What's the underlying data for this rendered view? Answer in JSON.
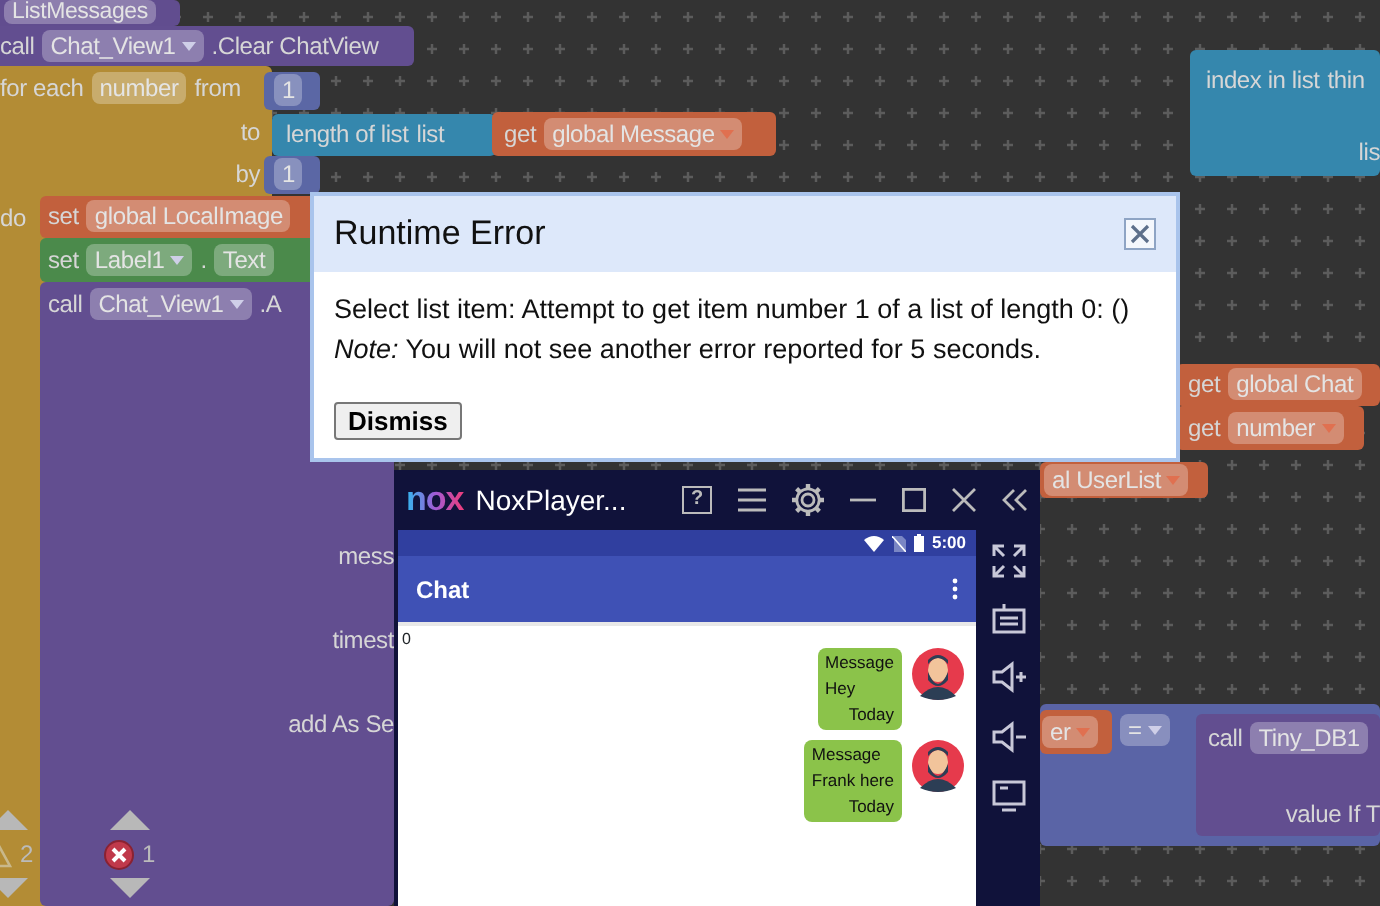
{
  "workspace": {
    "blocks": [
      {
        "kind": "procedure",
        "rows": [
          {
            "parts": [
              {
                "kind": "chip",
                "text": "ListMessages"
              }
            ]
          }
        ]
      },
      {
        "kind": "component",
        "rows": [
          {
            "parts": [
              {
                "kind": "word",
                "text": "call"
              },
              {
                "kind": "chip",
                "text": "Chat_View1",
                "dropdown": true
              },
              {
                "kind": "word",
                "text": ".Clear ChatView"
              }
            ]
          }
        ]
      },
      {
        "kind": "control",
        "rows": [
          {
            "parts": [
              {
                "kind": "word",
                "text": "for each"
              },
              {
                "kind": "chip",
                "text": "number"
              },
              {
                "kind": "word",
                "text": "from"
              }
            ]
          },
          {
            "parts": [
              {
                "kind": "word",
                "text": "to"
              }
            ]
          },
          {
            "parts": [
              {
                "kind": "word",
                "text": "by"
              }
            ]
          },
          {
            "parts": [
              {
                "kind": "word",
                "text": "do"
              }
            ]
          }
        ]
      },
      {
        "kind": "math",
        "rows": [
          {
            "parts": [
              {
                "kind": "chip",
                "text": "1"
              }
            ]
          }
        ]
      },
      {
        "kind": "list",
        "rows": [
          {
            "parts": [
              {
                "kind": "word",
                "text": "length of list"
              },
              {
                "kind": "word",
                "text": "list"
              }
            ]
          }
        ]
      },
      {
        "kind": "variable",
        "rows": [
          {
            "parts": [
              {
                "kind": "word",
                "text": "get"
              },
              {
                "kind": "chip",
                "text": "global Message",
                "dropdown": true
              }
            ]
          }
        ]
      },
      {
        "kind": "math",
        "rows": [
          {
            "parts": [
              {
                "kind": "chip",
                "text": "1"
              }
            ]
          }
        ]
      },
      {
        "kind": "variable",
        "rows": [
          {
            "parts": [
              {
                "kind": "word",
                "text": "set"
              },
              {
                "kind": "chip",
                "text": "global LocalImage"
              }
            ]
          }
        ]
      },
      {
        "kind": "text",
        "rows": [
          {
            "parts": [
              {
                "kind": "word",
                "text": "set"
              },
              {
                "kind": "chip",
                "text": "Label1",
                "dropdown": true
              },
              {
                "kind": "word",
                "text": "."
              },
              {
                "kind": "chip",
                "text": "Text"
              }
            ]
          }
        ]
      },
      {
        "kind": "component",
        "rows": [
          {
            "parts": [
              {
                "kind": "word",
                "text": "call"
              },
              {
                "kind": "chip",
                "text": "Chat_View1",
                "dropdown": true
              },
              {
                "kind": "word",
                "text": ".A"
              }
            ]
          },
          {
            "parts": [
              {
                "kind": "word",
                "text": "mess"
              }
            ]
          },
          {
            "parts": [
              {
                "kind": "word",
                "text": "timest"
              }
            ]
          },
          {
            "parts": [
              {
                "kind": "word",
                "text": "add As Se"
              }
            ]
          }
        ]
      },
      {
        "kind": "list",
        "rows": [
          {
            "parts": [
              {
                "kind": "word",
                "text": "index in list"
              },
              {
                "kind": "word",
                "text": "thin"
              }
            ]
          },
          {
            "parts": [
              {
                "kind": "word",
                "text": "lis"
              }
            ]
          }
        ]
      },
      {
        "kind": "variable",
        "rows": [
          {
            "parts": [
              {
                "kind": "word",
                "text": "get"
              },
              {
                "kind": "chip",
                "text": "global Chat"
              }
            ]
          }
        ]
      },
      {
        "kind": "variable",
        "rows": [
          {
            "parts": [
              {
                "kind": "word",
                "text": "get"
              },
              {
                "kind": "chip",
                "text": "number",
                "dropdown": true
              }
            ]
          }
        ]
      },
      {
        "kind": "variable",
        "rows": [
          {
            "parts": [
              {
                "kind": "chip",
                "text": "al UserList",
                "dropdown": true
              }
            ]
          }
        ]
      },
      {
        "kind": "variable",
        "rows": [
          {
            "parts": [
              {
                "kind": "chip",
                "text": "er",
                "dropdown": true
              }
            ]
          }
        ]
      },
      {
        "kind": "logic",
        "rows": [
          {
            "parts": [
              {
                "kind": "chip",
                "text": "=",
                "dropdown": true
              }
            ]
          }
        ]
      },
      {
        "kind": "component",
        "rows": [
          {
            "parts": [
              {
                "kind": "word",
                "text": "call"
              },
              {
                "kind": "chip",
                "text": "Tiny_DB1"
              }
            ]
          },
          {
            "parts": [
              {
                "kind": "word",
                "text": "value If T"
              }
            ]
          }
        ]
      }
    ],
    "indicators": [
      {
        "kind": "warning",
        "count": "2"
      },
      {
        "kind": "error",
        "count": "1"
      }
    ]
  },
  "dialog": {
    "title": "Runtime Error",
    "message": "Select list item: Attempt to get item number 1 of a list of length 0: ()",
    "note": "*Note:* You will not see another error reported for 5 seconds.",
    "button": "Dismiss"
  },
  "emulator": {
    "logo": "nox",
    "title": "NoxPlayer...",
    "help": "?",
    "android": {
      "time": "5:00",
      "app_title": "Chat",
      "counter": "0",
      "messages": [
        {
          "label": "Message",
          "text": "Hey",
          "time": "Today"
        },
        {
          "label": "Message",
          "text": "Frank here",
          "time": "Today"
        }
      ]
    }
  }
}
